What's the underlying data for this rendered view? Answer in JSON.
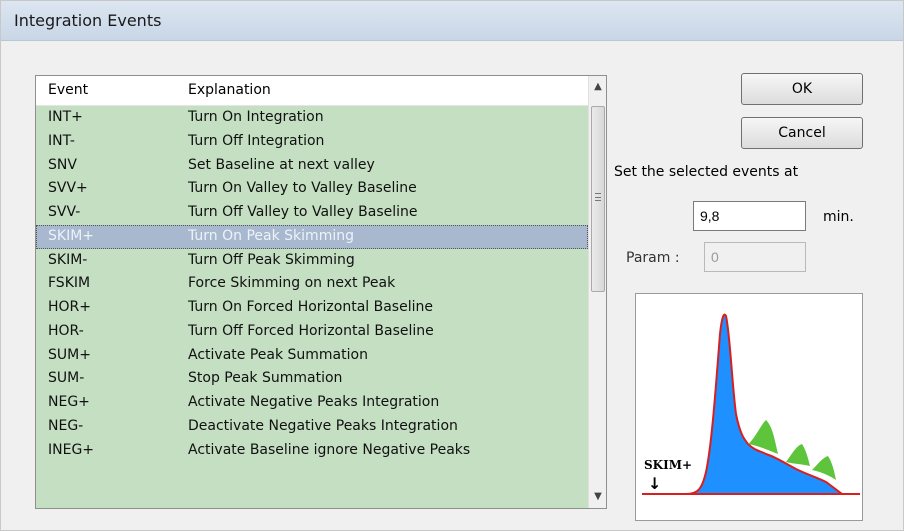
{
  "window": {
    "title": "Integration Events"
  },
  "list": {
    "columns": [
      "Event",
      "Explanation"
    ],
    "selected_index": 5,
    "rows": [
      {
        "event": "INT+",
        "explanation": "Turn On Integration"
      },
      {
        "event": "INT-",
        "explanation": "Turn Off Integration"
      },
      {
        "event": "SNV",
        "explanation": "Set Baseline at next valley"
      },
      {
        "event": "SVV+",
        "explanation": "Turn On Valley to Valley Baseline"
      },
      {
        "event": "SVV-",
        "explanation": "Turn Off Valley to Valley Baseline"
      },
      {
        "event": "SKIM+",
        "explanation": "Turn On Peak Skimming"
      },
      {
        "event": "SKIM-",
        "explanation": "Turn Off Peak Skimming"
      },
      {
        "event": "FSKIM",
        "explanation": "Force Skimming on next Peak"
      },
      {
        "event": "HOR+",
        "explanation": "Turn On Forced Horizontal Baseline"
      },
      {
        "event": "HOR-",
        "explanation": "Turn Off Forced Horizontal Baseline"
      },
      {
        "event": "SUM+",
        "explanation": "Activate Peak Summation"
      },
      {
        "event": "SUM-",
        "explanation": "Stop Peak Summation"
      },
      {
        "event": "NEG+",
        "explanation": "Activate Negative Peaks Integration"
      },
      {
        "event": "NEG-",
        "explanation": "Deactivate Negative Peaks Integration"
      },
      {
        "event": "INEG+",
        "explanation": "Activate Baseline ignore Negative Peaks"
      }
    ]
  },
  "buttons": {
    "ok": "OK",
    "cancel": "Cancel"
  },
  "settings": {
    "label": "Set the selected events at",
    "time_value": "9,8",
    "time_unit": "min.",
    "param_label": "Param :",
    "param_value": "0"
  },
  "preview": {
    "label": "SKIM+",
    "arrow": "↓"
  },
  "colors": {
    "row_background": "#c5dfc3",
    "selected_row": "#a8b8cf",
    "peak_fill": "#1e90ff",
    "skim_fill": "#5ec43c",
    "baseline": "#d62020"
  },
  "icons": {
    "scroll_up": "▲",
    "scroll_down": "▼"
  }
}
